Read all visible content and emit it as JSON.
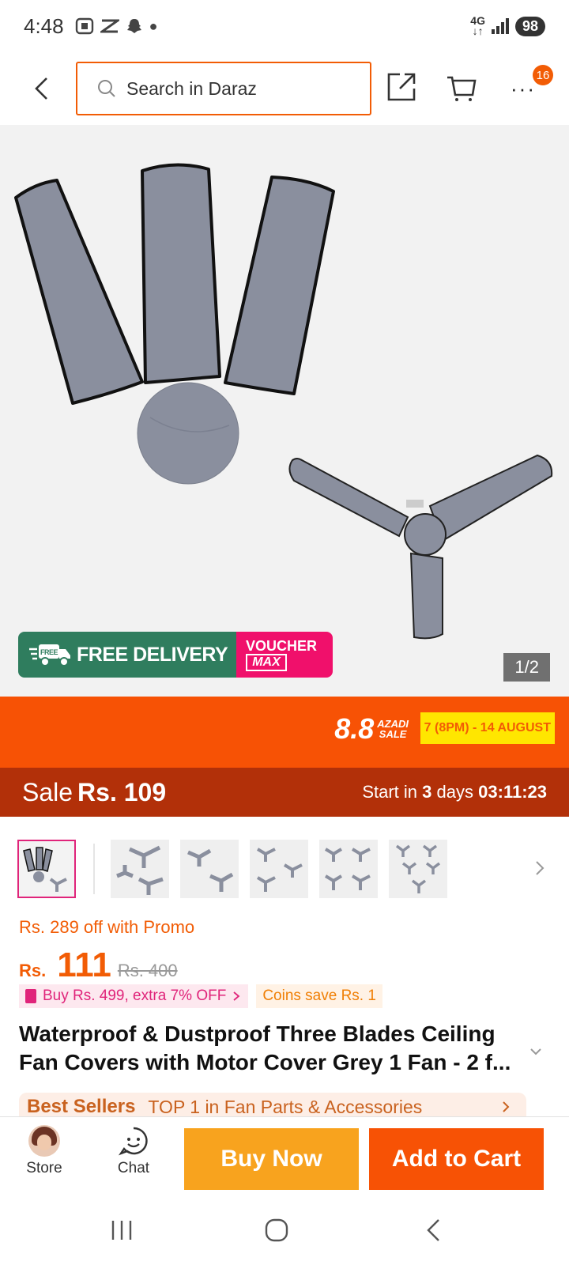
{
  "status_bar": {
    "time": "4:48",
    "network": "4G",
    "battery": "98"
  },
  "search": {
    "placeholder": "Search in Daraz"
  },
  "header": {
    "more_badge": "16"
  },
  "gallery": {
    "badge_free_delivery": "FREE DELIVERY",
    "badge_free_small": "FREE",
    "badge_voucher": "VOUCHER",
    "badge_max": "MAX",
    "counter": "1/2"
  },
  "campaign": {
    "logo_big": "8.8",
    "logo_small_1": "AZADI",
    "logo_small_2": "SALE",
    "date": "7 (8PM) - 14 AUGUST"
  },
  "sale_bar": {
    "label": "Sale",
    "price": "Rs. 109",
    "start_prefix": "Start in",
    "start_days": "3",
    "start_days_label": "days",
    "countdown": "03:11:23"
  },
  "product": {
    "promo_text": "Rs. 289 off with Promo",
    "currency": "Rs.",
    "price": "111",
    "original_price": "Rs. 400",
    "tag_bundle": "Buy Rs. 499, extra 7% OFF",
    "tag_coins": "Coins save Rs. 1",
    "title": "Waterproof & Dustproof Three Blades Ceiling Fan Covers with Motor Cover Grey 1 Fan - 2 f...",
    "best_sellers_label": "Best Sellers",
    "best_sellers_rank": "TOP 1 in Fan Parts & Accessories"
  },
  "bottom_bar": {
    "store": "Store",
    "chat": "Chat",
    "buy_now": "Buy Now",
    "add_to_cart": "Add to Cart"
  },
  "colors": {
    "brand_orange": "#f75205",
    "sale_red": "#b23009",
    "buy_now": "#f8a31e",
    "voucher_pink": "#f0106b",
    "free_delivery_green": "#2f7d5e"
  }
}
